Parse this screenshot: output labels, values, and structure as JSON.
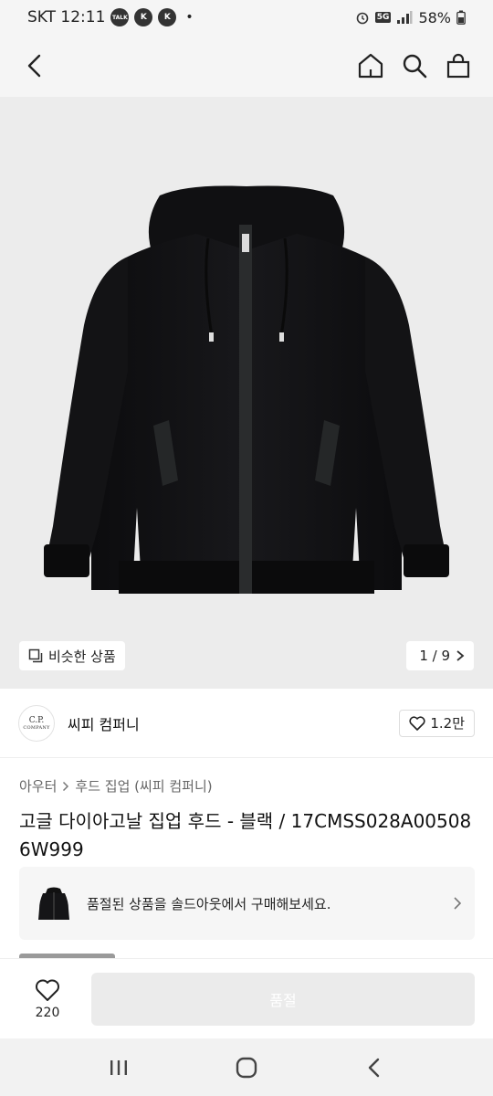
{
  "status": {
    "carrier_time": "SKT 12:11",
    "badges": [
      "TALK",
      "K",
      "K"
    ],
    "dot": "•",
    "network": "5G",
    "battery": "58%"
  },
  "nav": {
    "back_icon": "chevron-left-icon",
    "home_icon": "home-icon",
    "search_icon": "search-icon",
    "bag_icon": "shopping-bag-icon"
  },
  "gallery": {
    "similar_label": "비슷한 상품",
    "page_indicator": "1 / 9"
  },
  "brand": {
    "logo_line1": "C.P.",
    "logo_line2": "COMPANY",
    "name": "씨피 컴퍼니",
    "likes": "1.2만"
  },
  "product": {
    "category": "아우터",
    "subcategory": "후드 집업 (씨피 컴퍼니)",
    "title": "고글 다이아고날 집업 후드 - 블랙 / 17CMSS028A005086W999"
  },
  "banner": {
    "text": "품절된 상품을 솔드아웃에서 구매해보세요."
  },
  "action": {
    "wish_count": "220",
    "buy_label": "품절"
  },
  "colors": {
    "jacket": "#141416",
    "image_bg": "#ececec",
    "buy_disabled": "#ebebeb"
  }
}
